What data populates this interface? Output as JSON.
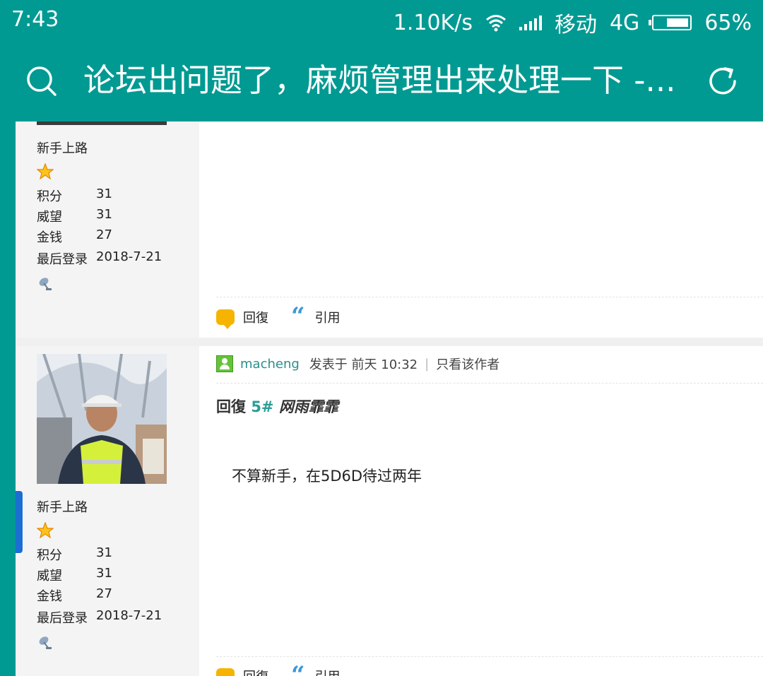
{
  "status_bar": {
    "time": "7:43",
    "net_speed": "1.10K/s",
    "carrier": "移动",
    "network": "4G",
    "battery_percent": "65%",
    "battery_level": 0.65
  },
  "header": {
    "title": "论坛出问题了，麻烦管理出来处理一下 -...",
    "search_icon": "search-icon",
    "refresh_icon": "refresh-icon",
    "color": "#009a92"
  },
  "posts": [
    {
      "rank": "新手上路",
      "stats": [
        {
          "label": "积分",
          "value": "31"
        },
        {
          "label": "威望",
          "value": "31"
        },
        {
          "label": "金钱",
          "value": "27"
        },
        {
          "label": "最后登录",
          "value": "2018-7-21"
        }
      ],
      "actions": {
        "reply": "回復",
        "quote": "引用"
      }
    },
    {
      "username": "macheng",
      "posted_label": "发表于",
      "posted_time": "前天 10:32",
      "only_author": "只看该作者",
      "reply_prefix": "回復",
      "reply_floor": "5#",
      "reply_to": "网雨霏霏",
      "message": "不算新手，在5D6D待过两年",
      "rank": "新手上路",
      "stats": [
        {
          "label": "积分",
          "value": "31"
        },
        {
          "label": "威望",
          "value": "31"
        },
        {
          "label": "金钱",
          "value": "27"
        },
        {
          "label": "最后登录",
          "value": "2018-7-21"
        }
      ],
      "actions": {
        "reply": "回復",
        "quote": "引用"
      }
    }
  ]
}
